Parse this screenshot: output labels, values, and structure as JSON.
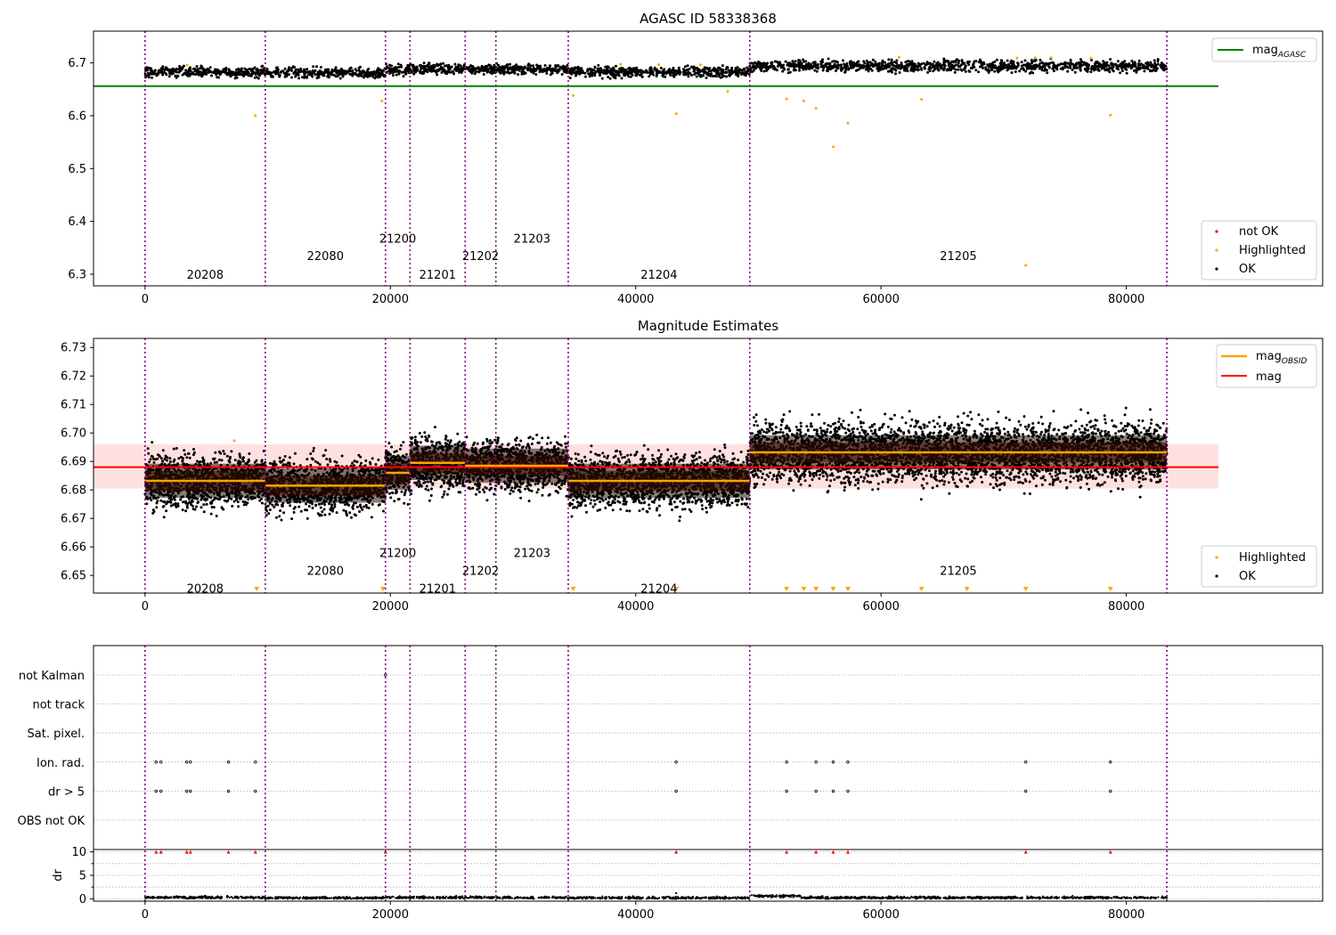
{
  "chart_data": [
    {
      "type": "scatter",
      "title": "AGASC ID 58338368",
      "xlim": [
        -4200,
        96000
      ],
      "ylim": [
        6.278,
        6.76
      ],
      "yticks": [
        6.3,
        6.4,
        6.5,
        6.6,
        6.7
      ],
      "xticks": [
        0,
        20000,
        40000,
        60000,
        80000
      ],
      "grid": false,
      "lines": [
        {
          "name": "mag_AGASC",
          "color": "#008000",
          "x": [
            -4200,
            87500
          ],
          "y": [
            6.656,
            6.656
          ]
        }
      ],
      "segments": [
        {
          "obsid": "20208",
          "x0": 0,
          "x1": 9800,
          "center": 6.683
        },
        {
          "obsid": "22080",
          "x0": 9800,
          "x1": 19600,
          "center": 6.681
        },
        {
          "obsid": "21200",
          "x0": 19600,
          "x1": 21600,
          "center": 6.686
        },
        {
          "obsid": "21201",
          "x0": 21600,
          "x1": 26100,
          "center": 6.689
        },
        {
          "obsid": "21202",
          "x0": 26100,
          "x1": 28600,
          "center": 6.688
        },
        {
          "obsid": "21203",
          "x0": 28600,
          "x1": 34500,
          "center": 6.688
        },
        {
          "obsid": "21204",
          "x0": 34500,
          "x1": 49300,
          "center": 6.683
        },
        {
          "obsid": "21205",
          "x0": 49300,
          "x1": 83300,
          "center": 6.694
        }
      ],
      "highlighted_outliers": [
        {
          "x": 9000,
          "y": 6.6
        },
        {
          "x": 19300,
          "y": 6.628
        },
        {
          "x": 34900,
          "y": 6.638
        },
        {
          "x": 43300,
          "y": 6.604
        },
        {
          "x": 47500,
          "y": 6.646
        },
        {
          "x": 52300,
          "y": 6.632
        },
        {
          "x": 53700,
          "y": 6.628
        },
        {
          "x": 54700,
          "y": 6.614
        },
        {
          "x": 56100,
          "y": 6.541
        },
        {
          "x": 57300,
          "y": 6.586
        },
        {
          "x": 63300,
          "y": 6.631
        },
        {
          "x": 71800,
          "y": 6.317
        },
        {
          "x": 78700,
          "y": 6.601
        }
      ],
      "labels": [
        {
          "text": "20208",
          "x": 4900,
          "y": 6.3
        },
        {
          "text": "22080",
          "x": 14700,
          "y": 6.335
        },
        {
          "text": "21200",
          "x": 20600,
          "y": 6.368
        },
        {
          "text": "21201",
          "x": 23850,
          "y": 6.3
        },
        {
          "text": "21202",
          "x": 27350,
          "y": 6.335
        },
        {
          "text": "21203",
          "x": 31550,
          "y": 6.368
        },
        {
          "text": "21204",
          "x": 41900,
          "y": 6.3
        },
        {
          "text": "21205",
          "x": 66300,
          "y": 6.335
        }
      ],
      "legend_top": {
        "placement": "top-right",
        "label_main": "mag",
        "label_sub": "AGASC"
      },
      "legend_bottom": {
        "placement": "bottom-right",
        "entries": [
          {
            "label": "not OK",
            "color": "#ff0000"
          },
          {
            "label": "Highlighted",
            "color": "#ffa500"
          },
          {
            "label": "OK",
            "color": "#000000"
          }
        ]
      }
    },
    {
      "type": "scatter",
      "title": "Magnitude Estimates",
      "xlim": [
        -4200,
        96000
      ],
      "ylim": [
        6.6438,
        6.7332
      ],
      "yticks": [
        6.65,
        6.66,
        6.67,
        6.68,
        6.69,
        6.7,
        6.71,
        6.72,
        6.73
      ],
      "xticks": [
        0,
        20000,
        40000,
        60000,
        80000
      ],
      "grid": false,
      "mag": {
        "value": 6.688,
        "band": [
          6.6805,
          6.696
        ],
        "x": [
          -4200,
          87500
        ],
        "color": "#ff0000"
      },
      "segments": [
        {
          "obsid": "20208",
          "x0": 0,
          "x1": 9800,
          "center": 6.6832
        },
        {
          "obsid": "22080",
          "x0": 9800,
          "x1": 19600,
          "center": 6.6815
        },
        {
          "obsid": "21200",
          "x0": 19600,
          "x1": 21600,
          "center": 6.686
        },
        {
          "obsid": "21201",
          "x0": 21600,
          "x1": 26100,
          "center": 6.6895
        },
        {
          "obsid": "21202",
          "x0": 26100,
          "x1": 28600,
          "center": 6.6885
        },
        {
          "obsid": "21203",
          "x0": 28600,
          "x1": 34500,
          "center": 6.6885
        },
        {
          "obsid": "21204",
          "x0": 34500,
          "x1": 49300,
          "center": 6.6832
        },
        {
          "obsid": "21205",
          "x0": 49300,
          "x1": 83300,
          "center": 6.6932
        }
      ],
      "off_scale_markers_x": [
        9100,
        19400,
        34900,
        43300,
        52300,
        53700,
        54700,
        56100,
        57300,
        63300,
        67000,
        71800,
        78700
      ],
      "labels": [
        {
          "text": "20208",
          "x": 4900,
          "y": 6.6455
        },
        {
          "text": "22080",
          "x": 14700,
          "y": 6.6518
        },
        {
          "text": "21200",
          "x": 20600,
          "y": 6.658
        },
        {
          "text": "21201",
          "x": 23850,
          "y": 6.6455
        },
        {
          "text": "21202",
          "x": 27350,
          "y": 6.6518
        },
        {
          "text": "21203",
          "x": 31550,
          "y": 6.658
        },
        {
          "text": "21204",
          "x": 41900,
          "y": 6.6455
        },
        {
          "text": "21205",
          "x": 66300,
          "y": 6.6518
        }
      ],
      "legend_top": {
        "placement": "top-right",
        "entries": [
          {
            "label_main": "mag",
            "label_sub": "OBSID",
            "color": "#ffa500"
          },
          {
            "label_main": "mag",
            "label_sub": "",
            "color": "#ff0000"
          }
        ]
      },
      "legend_bottom": {
        "placement": "bottom-right",
        "entries": [
          {
            "label": "Highlighted",
            "color": "#ffa500"
          },
          {
            "label": "OK",
            "color": "#000000"
          }
        ]
      }
    },
    {
      "type": "scatter",
      "title": "",
      "xlim": [
        -4200,
        96000
      ],
      "xticks": [
        0,
        20000,
        40000,
        60000,
        80000
      ],
      "flag_rows": [
        "not Kalman",
        "not track",
        "Sat. pixel.",
        "Ion. rad.",
        "dr > 5",
        "OBS not OK"
      ],
      "flag_events": [
        {
          "flag": "not Kalman",
          "x": [
            19600
          ]
        },
        {
          "flag": "Ion. rad.",
          "x": [
            900,
            1300,
            3400,
            3700,
            6800,
            9000,
            43300,
            52300,
            54700,
            56100,
            57300,
            71800,
            78700
          ]
        },
        {
          "flag": "dr > 5",
          "x": [
            900,
            1300,
            3400,
            3700,
            6800,
            9000,
            43300,
            52300,
            54700,
            56100,
            57300,
            71800,
            78700
          ]
        }
      ],
      "dr": {
        "ylabel": "dr",
        "ylim": [
          -0.5,
          10.5
        ],
        "yticks": [
          0,
          5,
          10
        ],
        "clipped_at_10_x": [
          900,
          1300,
          3400,
          3700,
          6800,
          9000,
          19600,
          43300,
          52300,
          54700,
          56100,
          57300,
          71800,
          78700
        ],
        "baseline": [
          {
            "x0": 0,
            "x1": 9800,
            "y": 0.3
          },
          {
            "x0": 9800,
            "x1": 19600,
            "y": 0.2
          },
          {
            "x0": 19600,
            "x1": 28600,
            "y": 0.3
          },
          {
            "x0": 28600,
            "x1": 34500,
            "y": 0.25
          },
          {
            "x0": 34500,
            "x1": 49300,
            "y": 0.2
          },
          {
            "x0": 49300,
            "x1": 53500,
            "y": 0.6
          },
          {
            "x0": 53500,
            "x1": 83300,
            "y": 0.25
          }
        ]
      }
    }
  ]
}
